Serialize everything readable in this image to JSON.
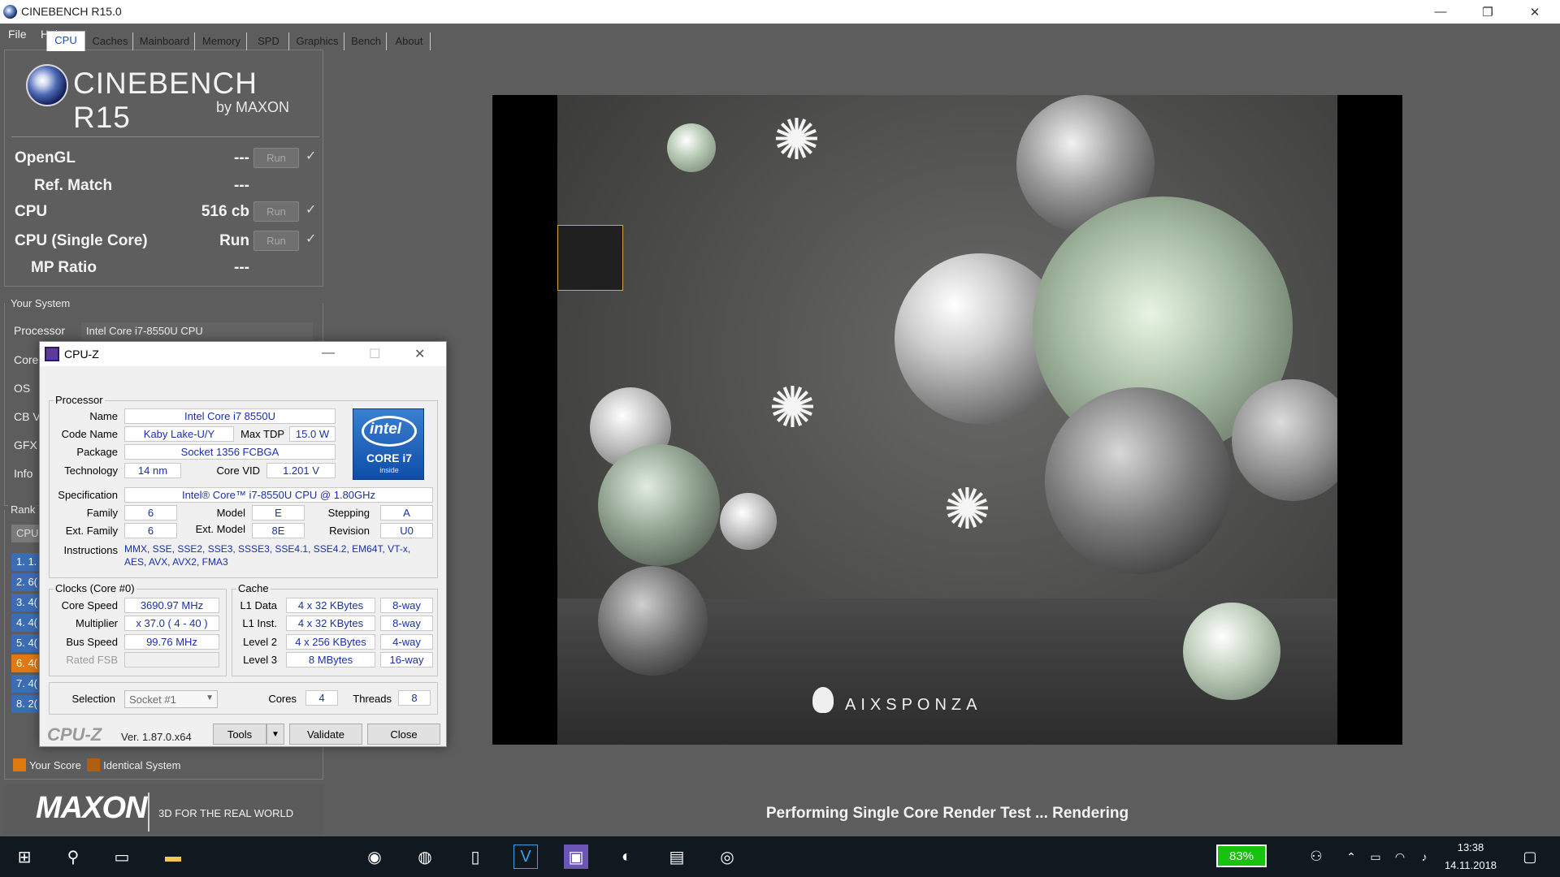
{
  "window": {
    "title": "CINEBENCH R15.0",
    "minimize": "—",
    "restore": "❐",
    "close": "✕"
  },
  "menu": [
    "File",
    "Help"
  ],
  "logo": {
    "name": "CINEBENCH R15",
    "by": "by MAXON"
  },
  "bench": [
    {
      "label": "OpenGL",
      "value": "---",
      "button": "Run",
      "check": "✓"
    },
    {
      "label": "Ref. Match",
      "value": "---"
    },
    {
      "label": "CPU",
      "value": "516 cb",
      "button": "Run",
      "check": "✓"
    },
    {
      "label": "CPU (Single Core)",
      "value": "Run",
      "button": "Run",
      "check": "✓"
    },
    {
      "label": "MP Ratio",
      "value": "---"
    }
  ],
  "your_system": {
    "title": "Your System",
    "processor_label": "Processor",
    "processor_value": "Intel Core i7-8550U CPU",
    "partial_labels": [
      "Core",
      "OS",
      "CB V",
      "GFX",
      "Info"
    ]
  },
  "ranking": {
    "title": "Rank",
    "tab": "CPU",
    "rows": [
      "1. 1.",
      "2. 6(",
      "3. 4(",
      "4. 4(",
      "5. 4(",
      "6. 4(",
      "7. 4(",
      "8. 2("
    ],
    "colors": [
      "#3c6db3",
      "#3c6db3",
      "#3c6db3",
      "#3c6db3",
      "#3c6db3",
      "#e07a10",
      "#3c6db3",
      "#3c6db3"
    ]
  },
  "legend": {
    "your_score": "Your Score",
    "identical": "Identical System",
    "your_score_color": "#e07a10",
    "identical_color": "#b25e10"
  },
  "maxon": {
    "logo": "MAXON",
    "tagline": "3D FOR THE REAL WORLD"
  },
  "render": {
    "watermark": "AIXSPONZA",
    "status": "Performing Single Core Render Test ... Rendering"
  },
  "cpuz": {
    "title": "CPU-Z",
    "tabs": [
      "CPU",
      "Caches",
      "Mainboard",
      "Memory",
      "SPD",
      "Graphics",
      "Bench",
      "About"
    ],
    "processor": {
      "group": "Processor",
      "name_label": "Name",
      "name": "Intel Core i7 8550U",
      "code_label": "Code Name",
      "code": "Kaby Lake-U/Y",
      "tdp_label": "Max TDP",
      "tdp": "15.0 W",
      "package_label": "Package",
      "package": "Socket 1356 FCBGA",
      "tech_label": "Technology",
      "tech": "14 nm",
      "vid_label": "Core VID",
      "vid": "1.201 V",
      "spec_label": "Specification",
      "spec": "Intel® Core™ i7-8550U CPU @ 1.80GHz",
      "family_label": "Family",
      "family": "6",
      "model_label": "Model",
      "model": "E",
      "stepping_label": "Stepping",
      "stepping": "A",
      "extfamily_label": "Ext. Family",
      "extfamily": "6",
      "extmodel_label": "Ext. Model",
      "extmodel": "8E",
      "revision_label": "Revision",
      "revision": "U0",
      "instr_label": "Instructions",
      "instr": "MMX, SSE, SSE2, SSE3, SSSE3, SSE4.1, SSE4.2, EM64T, VT-x, AES, AVX, AVX2, FMA3"
    },
    "intel_badge": {
      "brand": "intel",
      "line": "CORE i7",
      "inside": "inside"
    },
    "clocks": {
      "group": "Clocks (Core #0)",
      "speed_label": "Core Speed",
      "speed": "3690.97 MHz",
      "mult_label": "Multiplier",
      "mult": "x 37.0 ( 4 - 40 )",
      "bus_label": "Bus Speed",
      "bus": "99.76 MHz",
      "fsb_label": "Rated FSB",
      "fsb": ""
    },
    "cache": {
      "group": "Cache",
      "l1d_label": "L1 Data",
      "l1d": "4 x 32 KBytes",
      "l1d_way": "8-way",
      "l1i_label": "L1 Inst.",
      "l1i": "4 x 32 KBytes",
      "l1i_way": "8-way",
      "l2_label": "Level 2",
      "l2": "4 x 256 KBytes",
      "l2_way": "4-way",
      "l3_label": "Level 3",
      "l3": "8 MBytes",
      "l3_way": "16-way"
    },
    "selection": {
      "label": "Selection",
      "value": "Socket #1",
      "cores_label": "Cores",
      "cores": "4",
      "threads_label": "Threads",
      "threads": "8"
    },
    "footer": {
      "brand": "CPU-Z",
      "version": "Ver. 1.87.0.x64",
      "tools": "Tools",
      "validate": "Validate",
      "close": "Close"
    }
  },
  "taskbar": {
    "battery": "83%",
    "time": "13:38",
    "date": "14.11.2018"
  }
}
